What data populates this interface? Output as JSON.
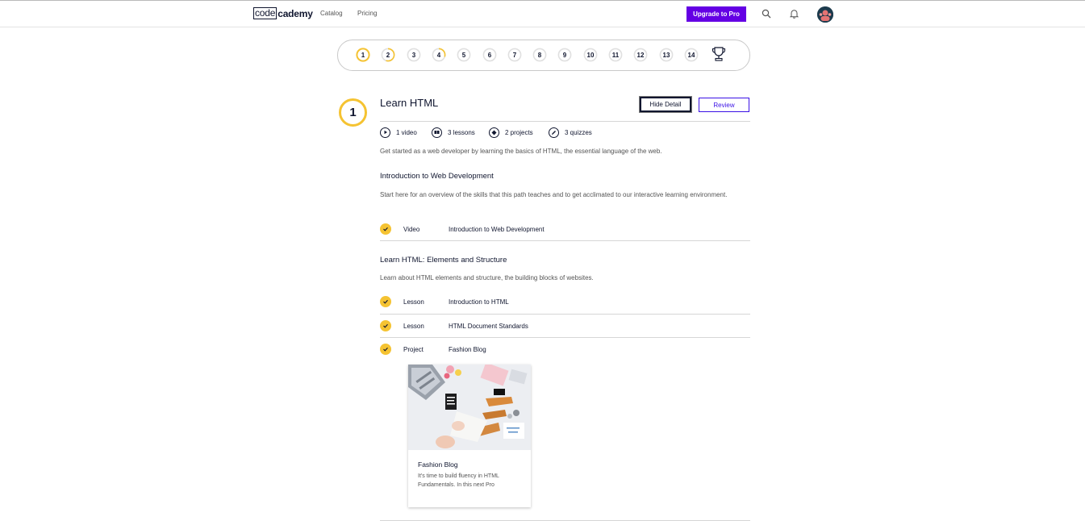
{
  "header": {
    "logo_code": "code",
    "logo_academy": "cademy",
    "nav": [
      "Catalog",
      "Pricing"
    ],
    "upgrade_label": "Upgrade to Pro",
    "accent_color": "#6400e4",
    "icons": [
      "search-icon",
      "bell-icon",
      "avatar"
    ]
  },
  "stepper": {
    "steps": [
      {
        "label": "1",
        "progress": 1.0,
        "active": true
      },
      {
        "label": "2",
        "progress": 0.55,
        "active": false
      },
      {
        "label": "3",
        "progress": 0,
        "active": false
      },
      {
        "label": "4",
        "progress": 0.3,
        "active": false
      },
      {
        "label": "5",
        "progress": 0,
        "active": false
      },
      {
        "label": "6",
        "progress": 0,
        "active": false
      },
      {
        "label": "7",
        "progress": 0,
        "active": false
      },
      {
        "label": "8",
        "progress": 0,
        "active": false
      },
      {
        "label": "9",
        "progress": 0,
        "active": false
      },
      {
        "label": "10",
        "progress": 0,
        "active": false
      },
      {
        "label": "11",
        "progress": 0,
        "active": false
      },
      {
        "label": "12",
        "progress": 0,
        "active": false
      },
      {
        "label": "13",
        "progress": 0,
        "active": false
      },
      {
        "label": "14",
        "progress": 0,
        "active": false
      }
    ],
    "trophy_icon": "trophy-icon",
    "progress_color": "#f5c332"
  },
  "unit": {
    "number": "1",
    "title": "Learn HTML",
    "hide_detail_label": "Hide Detail",
    "review_label": "Review",
    "stats": {
      "video": "1 video",
      "lessons": "3 lessons",
      "projects": "2 projects",
      "quizzes": "3 quizzes"
    },
    "description": "Get started as a web developer by learning the basics of HTML, the essential language of the web."
  },
  "sections": [
    {
      "title": "Introduction to Web Development",
      "description": "Start here for an overview of the skills that this path teaches and to get acclimated to our interactive learning environment.",
      "items": [
        {
          "type": "Video",
          "name": "Introduction to Web Development"
        }
      ]
    },
    {
      "title": "Learn HTML: Elements and Structure",
      "description": "Learn about HTML elements and structure, the building blocks of websites.",
      "items": [
        {
          "type": "Lesson",
          "name": "Introduction to HTML"
        },
        {
          "type": "Lesson",
          "name": "HTML Document Standards"
        },
        {
          "type": "Project",
          "name": "Fashion Blog"
        }
      ]
    }
  ],
  "project_card": {
    "title": "Fashion Blog",
    "description": "It's time to build fluency in HTML Fundamentals. In this next Pro"
  }
}
